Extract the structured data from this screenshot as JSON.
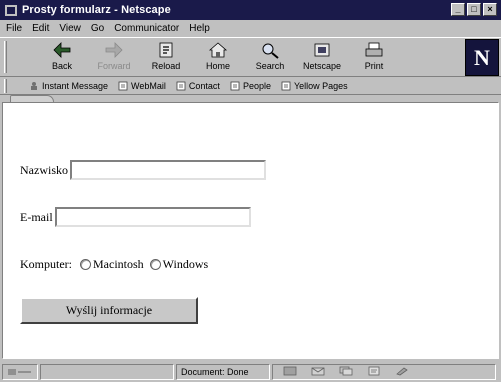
{
  "window": {
    "title": "Prosty formularz - Netscape",
    "controls": [
      "_",
      "□",
      "×"
    ]
  },
  "menu": [
    "File",
    "Edit",
    "View",
    "Go",
    "Communicator",
    "Help"
  ],
  "toolbar": {
    "buttons": [
      {
        "label": "Back",
        "icon": "back-arrow-icon",
        "disabled": false
      },
      {
        "label": "Forward",
        "icon": "forward-arrow-icon",
        "disabled": true
      },
      {
        "label": "Reload",
        "icon": "reload-icon",
        "disabled": false
      },
      {
        "label": "Home",
        "icon": "home-icon",
        "disabled": false
      },
      {
        "label": "Search",
        "icon": "search-icon",
        "disabled": false
      },
      {
        "label": "Netscape",
        "icon": "netscape-icon",
        "disabled": false
      },
      {
        "label": "Print",
        "icon": "print-icon",
        "disabled": false
      }
    ],
    "logo": "N"
  },
  "personal_toolbar": [
    "Instant Message",
    "WebMail",
    "Contact",
    "People",
    "Yellow Pages"
  ],
  "form": {
    "surname_label": "Nazwisko",
    "surname_value": "",
    "email_label": "E-mail",
    "email_value": "",
    "computer_label": "Komputer:",
    "option_mac": "Macintosh",
    "option_windows": "Windows",
    "submit_label": "Wyślij informacje"
  },
  "status": {
    "text": "Document: Done"
  },
  "colors": {
    "chrome": "#c0c0c0",
    "titlebar": "#1a1a4a",
    "content_bg": "#ffffff"
  }
}
